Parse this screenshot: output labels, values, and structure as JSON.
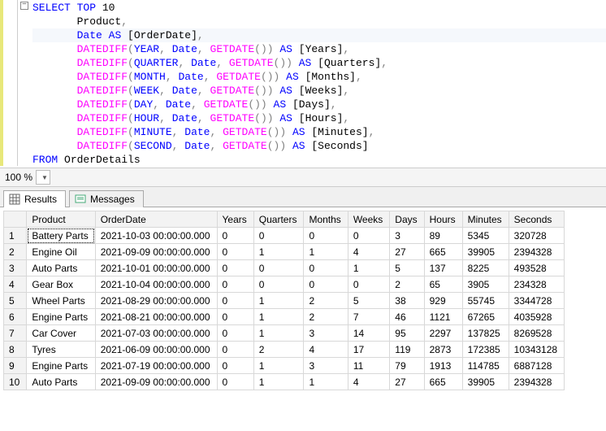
{
  "code": {
    "lines": [
      [
        [
          "kw-blue",
          "SELECT"
        ],
        [
          "txt",
          " "
        ],
        [
          "kw-blue",
          "TOP"
        ],
        [
          "txt",
          " 10"
        ]
      ],
      [
        [
          "txt",
          "       Product"
        ],
        [
          "kw-gray",
          ","
        ]
      ],
      [
        [
          "txt",
          "       "
        ],
        [
          "kw-blue",
          "Date"
        ],
        [
          "txt",
          " "
        ],
        [
          "kw-blue",
          "AS"
        ],
        [
          "txt",
          " [OrderDate]"
        ],
        [
          "kw-gray",
          ","
        ]
      ],
      [
        [
          "txt",
          "       "
        ],
        [
          "kw-pink",
          "DATEDIFF"
        ],
        [
          "kw-gray",
          "("
        ],
        [
          "kw-blue",
          "YEAR"
        ],
        [
          "kw-gray",
          ","
        ],
        [
          "txt",
          " "
        ],
        [
          "kw-blue",
          "Date"
        ],
        [
          "kw-gray",
          ","
        ],
        [
          "txt",
          " "
        ],
        [
          "kw-pink",
          "GETDATE"
        ],
        [
          "kw-gray",
          "())"
        ],
        [
          "txt",
          " "
        ],
        [
          "kw-blue",
          "AS"
        ],
        [
          "txt",
          " [Years]"
        ],
        [
          "kw-gray",
          ","
        ]
      ],
      [
        [
          "txt",
          "       "
        ],
        [
          "kw-pink",
          "DATEDIFF"
        ],
        [
          "kw-gray",
          "("
        ],
        [
          "kw-blue",
          "QUARTER"
        ],
        [
          "kw-gray",
          ","
        ],
        [
          "txt",
          " "
        ],
        [
          "kw-blue",
          "Date"
        ],
        [
          "kw-gray",
          ","
        ],
        [
          "txt",
          " "
        ],
        [
          "kw-pink",
          "GETDATE"
        ],
        [
          "kw-gray",
          "())"
        ],
        [
          "txt",
          " "
        ],
        [
          "kw-blue",
          "AS"
        ],
        [
          "txt",
          " [Quarters]"
        ],
        [
          "kw-gray",
          ","
        ]
      ],
      [
        [
          "txt",
          "       "
        ],
        [
          "kw-pink",
          "DATEDIFF"
        ],
        [
          "kw-gray",
          "("
        ],
        [
          "kw-blue",
          "MONTH"
        ],
        [
          "kw-gray",
          ","
        ],
        [
          "txt",
          " "
        ],
        [
          "kw-blue",
          "Date"
        ],
        [
          "kw-gray",
          ","
        ],
        [
          "txt",
          " "
        ],
        [
          "kw-pink",
          "GETDATE"
        ],
        [
          "kw-gray",
          "())"
        ],
        [
          "txt",
          " "
        ],
        [
          "kw-blue",
          "AS"
        ],
        [
          "txt",
          " [Months]"
        ],
        [
          "kw-gray",
          ","
        ]
      ],
      [
        [
          "txt",
          "       "
        ],
        [
          "kw-pink",
          "DATEDIFF"
        ],
        [
          "kw-gray",
          "("
        ],
        [
          "kw-blue",
          "WEEK"
        ],
        [
          "kw-gray",
          ","
        ],
        [
          "txt",
          " "
        ],
        [
          "kw-blue",
          "Date"
        ],
        [
          "kw-gray",
          ","
        ],
        [
          "txt",
          " "
        ],
        [
          "kw-pink",
          "GETDATE"
        ],
        [
          "kw-gray",
          "())"
        ],
        [
          "txt",
          " "
        ],
        [
          "kw-blue",
          "AS"
        ],
        [
          "txt",
          " [Weeks]"
        ],
        [
          "kw-gray",
          ","
        ]
      ],
      [
        [
          "txt",
          "       "
        ],
        [
          "kw-pink",
          "DATEDIFF"
        ],
        [
          "kw-gray",
          "("
        ],
        [
          "kw-blue",
          "DAY"
        ],
        [
          "kw-gray",
          ","
        ],
        [
          "txt",
          " "
        ],
        [
          "kw-blue",
          "Date"
        ],
        [
          "kw-gray",
          ","
        ],
        [
          "txt",
          " "
        ],
        [
          "kw-pink",
          "GETDATE"
        ],
        [
          "kw-gray",
          "())"
        ],
        [
          "txt",
          " "
        ],
        [
          "kw-blue",
          "AS"
        ],
        [
          "txt",
          " [Days]"
        ],
        [
          "kw-gray",
          ","
        ]
      ],
      [
        [
          "txt",
          "       "
        ],
        [
          "kw-pink",
          "DATEDIFF"
        ],
        [
          "kw-gray",
          "("
        ],
        [
          "kw-blue",
          "HOUR"
        ],
        [
          "kw-gray",
          ","
        ],
        [
          "txt",
          " "
        ],
        [
          "kw-blue",
          "Date"
        ],
        [
          "kw-gray",
          ","
        ],
        [
          "txt",
          " "
        ],
        [
          "kw-pink",
          "GETDATE"
        ],
        [
          "kw-gray",
          "())"
        ],
        [
          "txt",
          " "
        ],
        [
          "kw-blue",
          "AS"
        ],
        [
          "txt",
          " [Hours]"
        ],
        [
          "kw-gray",
          ","
        ]
      ],
      [
        [
          "txt",
          "       "
        ],
        [
          "kw-pink",
          "DATEDIFF"
        ],
        [
          "kw-gray",
          "("
        ],
        [
          "kw-blue",
          "MINUTE"
        ],
        [
          "kw-gray",
          ","
        ],
        [
          "txt",
          " "
        ],
        [
          "kw-blue",
          "Date"
        ],
        [
          "kw-gray",
          ","
        ],
        [
          "txt",
          " "
        ],
        [
          "kw-pink",
          "GETDATE"
        ],
        [
          "kw-gray",
          "())"
        ],
        [
          "txt",
          " "
        ],
        [
          "kw-blue",
          "AS"
        ],
        [
          "txt",
          " [Minutes]"
        ],
        [
          "kw-gray",
          ","
        ]
      ],
      [
        [
          "txt",
          "       "
        ],
        [
          "kw-pink",
          "DATEDIFF"
        ],
        [
          "kw-gray",
          "("
        ],
        [
          "kw-blue",
          "SECOND"
        ],
        [
          "kw-gray",
          ","
        ],
        [
          "txt",
          " "
        ],
        [
          "kw-blue",
          "Date"
        ],
        [
          "kw-gray",
          ","
        ],
        [
          "txt",
          " "
        ],
        [
          "kw-pink",
          "GETDATE"
        ],
        [
          "kw-gray",
          "())"
        ],
        [
          "txt",
          " "
        ],
        [
          "kw-blue",
          "AS"
        ],
        [
          "txt",
          " [Seconds]"
        ]
      ],
      [
        [
          "kw-blue",
          "FROM"
        ],
        [
          "txt",
          " OrderDetails"
        ]
      ]
    ],
    "highlight_row": 2
  },
  "zoom": {
    "value": "100 %"
  },
  "tabs": {
    "results": "Results",
    "messages": "Messages"
  },
  "grid": {
    "columns": [
      "Product",
      "OrderDate",
      "Years",
      "Quarters",
      "Months",
      "Weeks",
      "Days",
      "Hours",
      "Minutes",
      "Seconds"
    ],
    "rows": [
      [
        "Battery Parts",
        "2021-10-03 00:00:00.000",
        "0",
        "0",
        "0",
        "0",
        "3",
        "89",
        "5345",
        "320728"
      ],
      [
        "Engine Oil",
        "2021-09-09 00:00:00.000",
        "0",
        "1",
        "1",
        "4",
        "27",
        "665",
        "39905",
        "2394328"
      ],
      [
        "Auto Parts",
        "2021-10-01 00:00:00.000",
        "0",
        "0",
        "0",
        "1",
        "5",
        "137",
        "8225",
        "493528"
      ],
      [
        "Gear Box",
        "2021-10-04 00:00:00.000",
        "0",
        "0",
        "0",
        "0",
        "2",
        "65",
        "3905",
        "234328"
      ],
      [
        "Wheel Parts",
        "2021-08-29 00:00:00.000",
        "0",
        "1",
        "2",
        "5",
        "38",
        "929",
        "55745",
        "3344728"
      ],
      [
        "Engine Parts",
        "2021-08-21 00:00:00.000",
        "0",
        "1",
        "2",
        "7",
        "46",
        "1121",
        "67265",
        "4035928"
      ],
      [
        "Car Cover",
        "2021-07-03 00:00:00.000",
        "0",
        "1",
        "3",
        "14",
        "95",
        "2297",
        "137825",
        "8269528"
      ],
      [
        "Tyres",
        "2021-06-09 00:00:00.000",
        "0",
        "2",
        "4",
        "17",
        "119",
        "2873",
        "172385",
        "10343128"
      ],
      [
        "Engine Parts",
        "2021-07-19 00:00:00.000",
        "0",
        "1",
        "3",
        "11",
        "79",
        "1913",
        "114785",
        "6887128"
      ],
      [
        "Auto Parts",
        "2021-09-09 00:00:00.000",
        "0",
        "1",
        "1",
        "4",
        "27",
        "665",
        "39905",
        "2394328"
      ]
    ]
  },
  "chart_data": {
    "type": "table",
    "columns": [
      "Product",
      "OrderDate",
      "Years",
      "Quarters",
      "Months",
      "Weeks",
      "Days",
      "Hours",
      "Minutes",
      "Seconds"
    ],
    "rows": [
      [
        "Battery Parts",
        "2021-10-03 00:00:00.000",
        0,
        0,
        0,
        0,
        3,
        89,
        5345,
        320728
      ],
      [
        "Engine Oil",
        "2021-09-09 00:00:00.000",
        0,
        1,
        1,
        4,
        27,
        665,
        39905,
        2394328
      ],
      [
        "Auto Parts",
        "2021-10-01 00:00:00.000",
        0,
        0,
        0,
        1,
        5,
        137,
        8225,
        493528
      ],
      [
        "Gear Box",
        "2021-10-04 00:00:00.000",
        0,
        0,
        0,
        0,
        2,
        65,
        3905,
        234328
      ],
      [
        "Wheel Parts",
        "2021-08-29 00:00:00.000",
        0,
        1,
        2,
        5,
        38,
        929,
        55745,
        3344728
      ],
      [
        "Engine Parts",
        "2021-08-21 00:00:00.000",
        0,
        1,
        2,
        7,
        46,
        1121,
        67265,
        4035928
      ],
      [
        "Car Cover",
        "2021-07-03 00:00:00.000",
        0,
        1,
        3,
        14,
        95,
        2297,
        137825,
        8269528
      ],
      [
        "Tyres",
        "2021-06-09 00:00:00.000",
        0,
        2,
        4,
        17,
        119,
        2873,
        172385,
        10343128
      ],
      [
        "Engine Parts",
        "2021-07-19 00:00:00.000",
        0,
        1,
        3,
        11,
        79,
        1913,
        114785,
        6887128
      ],
      [
        "Auto Parts",
        "2021-09-09 00:00:00.000",
        0,
        1,
        1,
        4,
        27,
        665,
        39905,
        2394328
      ]
    ]
  }
}
